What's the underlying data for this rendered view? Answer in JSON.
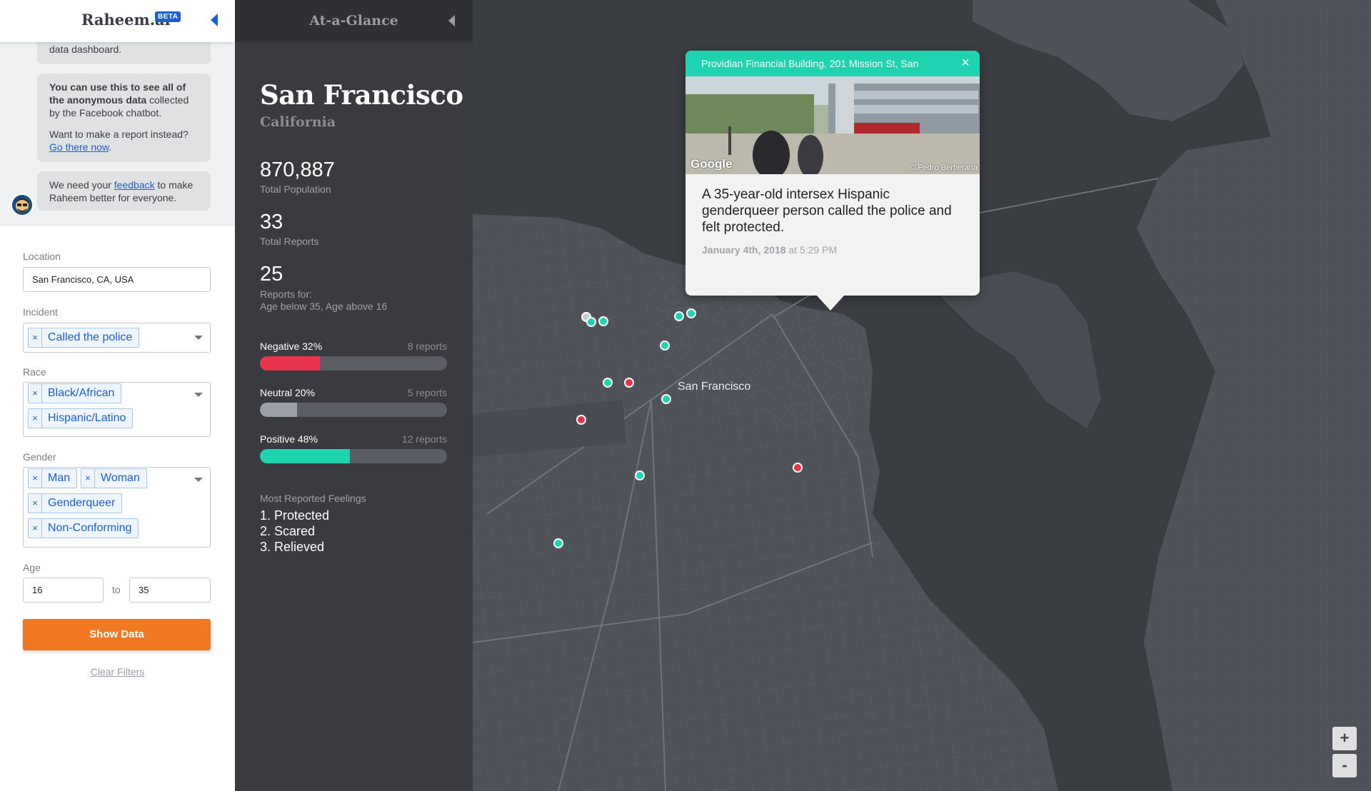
{
  "header": {
    "brand": "Raheem.ai",
    "badge": "BETA"
  },
  "chat": {
    "bubble1_text": "data dashboard.",
    "bubble2_bold": "You can use this to see all of the anonymous data",
    "bubble2_rest": " collected by the Facebook chatbot.",
    "bubble2_q": "Want to make a report instead?",
    "bubble2_link": "Go there now",
    "bubble2_end": ".",
    "bubble3_pre": "We need your ",
    "bubble3_link": "feedback",
    "bubble3_post": " to make Raheem better for everyone."
  },
  "filters": {
    "location_label": "Location",
    "location_value": "San Francisco, CA, USA",
    "incident_label": "Incident",
    "incident_tags": [
      "Called the police"
    ],
    "race_label": "Race",
    "race_tags": [
      "Black/African",
      "Hispanic/Latino"
    ],
    "gender_label": "Gender",
    "gender_tags": [
      "Man",
      "Woman",
      "Genderqueer",
      "Non-Conforming"
    ],
    "age_label": "Age",
    "age_min": "16",
    "age_to": "to",
    "age_max": "35",
    "tag_remove": "×",
    "show_button": "Show Data",
    "clear_link": "Clear Filters"
  },
  "glance": {
    "title": "At-a-Glance",
    "city": "San Francisco",
    "state": "California",
    "population": "870,887",
    "population_label": "Total Population",
    "reports": "33",
    "reports_label": "Total Reports",
    "filtered": "25",
    "filtered_label_1": "Reports for:",
    "filtered_label_2": "Age below 35, Age above 16",
    "bars": [
      {
        "label": "Negative 32%",
        "count": "8 reports",
        "fraction": 0.32,
        "color": "#e8334a"
      },
      {
        "label": "Neutral 20%",
        "count": "5 reports",
        "fraction": 0.2,
        "color": "#9aa0a6"
      },
      {
        "label": "Positive 48%",
        "count": "12 reports",
        "fraction": 0.48,
        "color": "#1fd3b1"
      }
    ],
    "feelings_title": "Most Reported Feelings",
    "feelings": [
      "1. Protected",
      "2. Scared",
      "3. Relieved"
    ]
  },
  "map": {
    "city_label": "San Francisco",
    "colors": {
      "positive": "#1fd3b1",
      "negative": "#e8334a",
      "neutral": "#c8ccd0",
      "water": "#3a3d42",
      "land": "#4f5359"
    },
    "popup": {
      "address": "Providian Financial Building, 201 Mission St, San",
      "close": "×",
      "photo_logo": "Google",
      "photo_credit": "© Pedro Berberana",
      "text": "A 35-year-old intersex Hispanic genderqueer person called the police and felt protected.",
      "date": "January 4th, 2018",
      "time": " at 5:29 PM"
    },
    "zoom_in": "+",
    "zoom_out": "-"
  }
}
